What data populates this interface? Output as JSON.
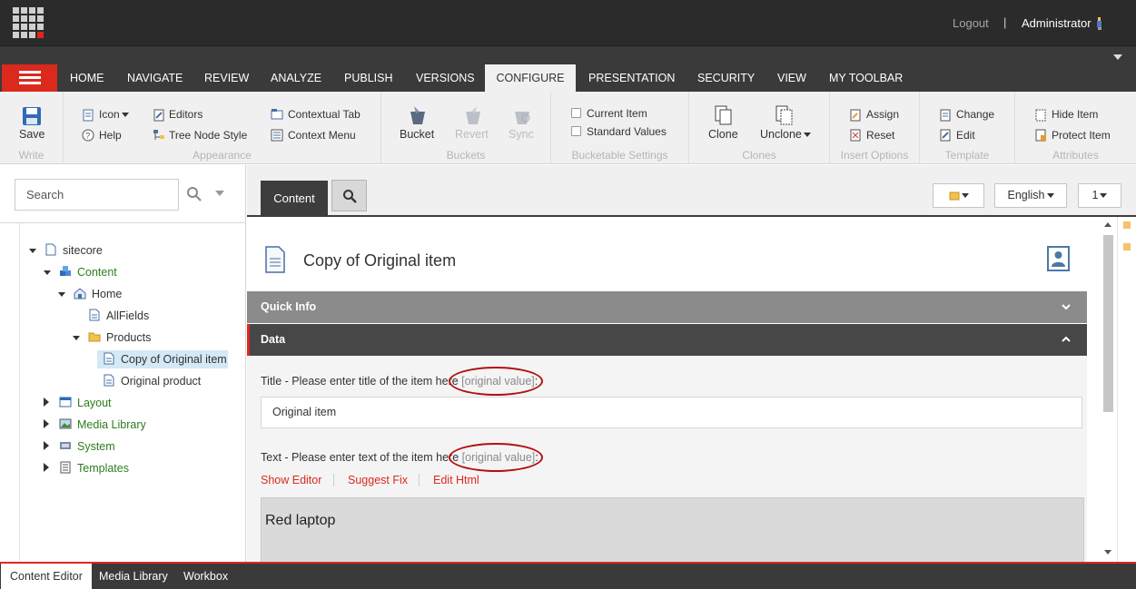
{
  "header": {
    "logout_label": "Logout",
    "separator": "|",
    "user_name": "Administrator"
  },
  "tabs": [
    "HOME",
    "NAVIGATE",
    "REVIEW",
    "ANALYZE",
    "PUBLISH",
    "VERSIONS",
    "CONFIGURE",
    "PRESENTATION",
    "SECURITY",
    "VIEW",
    "MY TOOLBAR"
  ],
  "active_tab": "CONFIGURE",
  "ribbon": {
    "write": {
      "label": "Write",
      "save": "Save"
    },
    "appearance": {
      "label": "Appearance",
      "icon": "Icon",
      "help": "Help",
      "editors": "Editors",
      "tree_node_style": "Tree Node Style",
      "contextual_tab": "Contextual Tab",
      "context_menu": "Context Menu"
    },
    "buckets": {
      "label": "Buckets",
      "bucket": "Bucket",
      "revert": "Revert",
      "sync": "Sync"
    },
    "bucketable": {
      "label": "Bucketable Settings",
      "current_item": "Current Item",
      "standard_values": "Standard Values"
    },
    "clones": {
      "label": "Clones",
      "clone": "Clone",
      "unclone": "Unclone"
    },
    "insert_options": {
      "label": "Insert Options",
      "assign": "Assign",
      "reset": "Reset"
    },
    "template": {
      "label": "Template",
      "change": "Change",
      "edit": "Edit"
    },
    "attributes": {
      "label": "Attributes",
      "hide_item": "Hide Item",
      "protect_item": "Protect Item"
    }
  },
  "search": {
    "placeholder": "Search"
  },
  "tree": [
    {
      "label": "sitecore",
      "icon": "document-icon"
    },
    {
      "label": "Content",
      "icon": "content-cubes-icon"
    },
    {
      "label": "Home",
      "icon": "home-icon"
    },
    {
      "label": "AllFields",
      "icon": "document-icon"
    },
    {
      "label": "Products",
      "icon": "folder-icon"
    },
    {
      "label": "Copy of Original item",
      "icon": "document-icon"
    },
    {
      "label": "Original product",
      "icon": "document-icon"
    },
    {
      "label": "Layout",
      "icon": "layout-icon"
    },
    {
      "label": "Media Library",
      "icon": "image-icon"
    },
    {
      "label": "System",
      "icon": "system-icon"
    },
    {
      "label": "Templates",
      "icon": "templates-icon"
    }
  ],
  "content_bar": {
    "content_tab": "Content",
    "language": "English",
    "version": "1"
  },
  "item": {
    "title": "Copy of Original item"
  },
  "sections": {
    "quick_info": "Quick Info",
    "data": "Data"
  },
  "fields": {
    "title": {
      "label": "Title - Please enter title of the item here ",
      "original_value": "[original value]",
      "suffix": ":",
      "value": "Original item"
    },
    "text": {
      "label": "Text - Please enter text of the item here ",
      "original_value": "[original value]",
      "suffix": ":",
      "links": [
        "Show Editor",
        "Suggest Fix",
        "Edit Html"
      ],
      "value": "Red laptop"
    }
  },
  "bottom_tabs": [
    "Content Editor",
    "Media Library",
    "Workbox"
  ],
  "colors": {
    "accent": "#dc291e",
    "dark": "#2b2b2b",
    "tree_green": "#2d7d1d",
    "selection": "#d4e8f6"
  }
}
